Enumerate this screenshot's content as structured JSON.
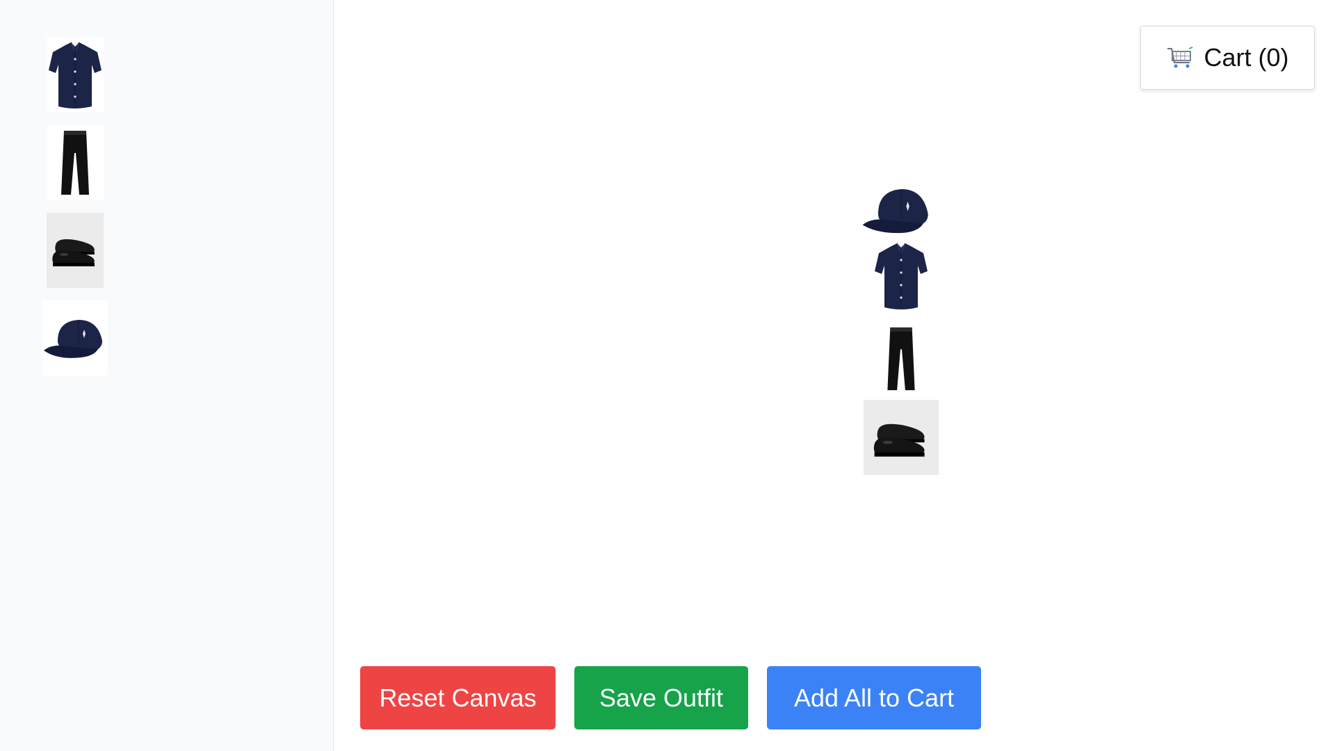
{
  "sidebar": {
    "items": [
      {
        "name": "shirt",
        "icon": "navy-shirt-icon"
      },
      {
        "name": "pants",
        "icon": "black-pants-icon"
      },
      {
        "name": "shoes",
        "icon": "black-loafers-icon"
      },
      {
        "name": "cap",
        "icon": "navy-cap-icon"
      }
    ]
  },
  "canvas": {
    "items": [
      {
        "name": "cap",
        "icon": "navy-cap-icon"
      },
      {
        "name": "shirt",
        "icon": "navy-shirt-icon"
      },
      {
        "name": "pants",
        "icon": "black-pants-icon"
      },
      {
        "name": "shoes",
        "icon": "black-loafers-icon"
      }
    ]
  },
  "cart": {
    "label": "Cart (0)",
    "icon": "shopping-cart-icon"
  },
  "actions": {
    "reset_label": "Reset Canvas",
    "save_label": "Save Outfit",
    "add_label": "Add All to Cart"
  },
  "colors": {
    "reset": "#ef4444",
    "save": "#16a34a",
    "add": "#3b82f6",
    "navy": "#1c2448",
    "black": "#111111"
  }
}
